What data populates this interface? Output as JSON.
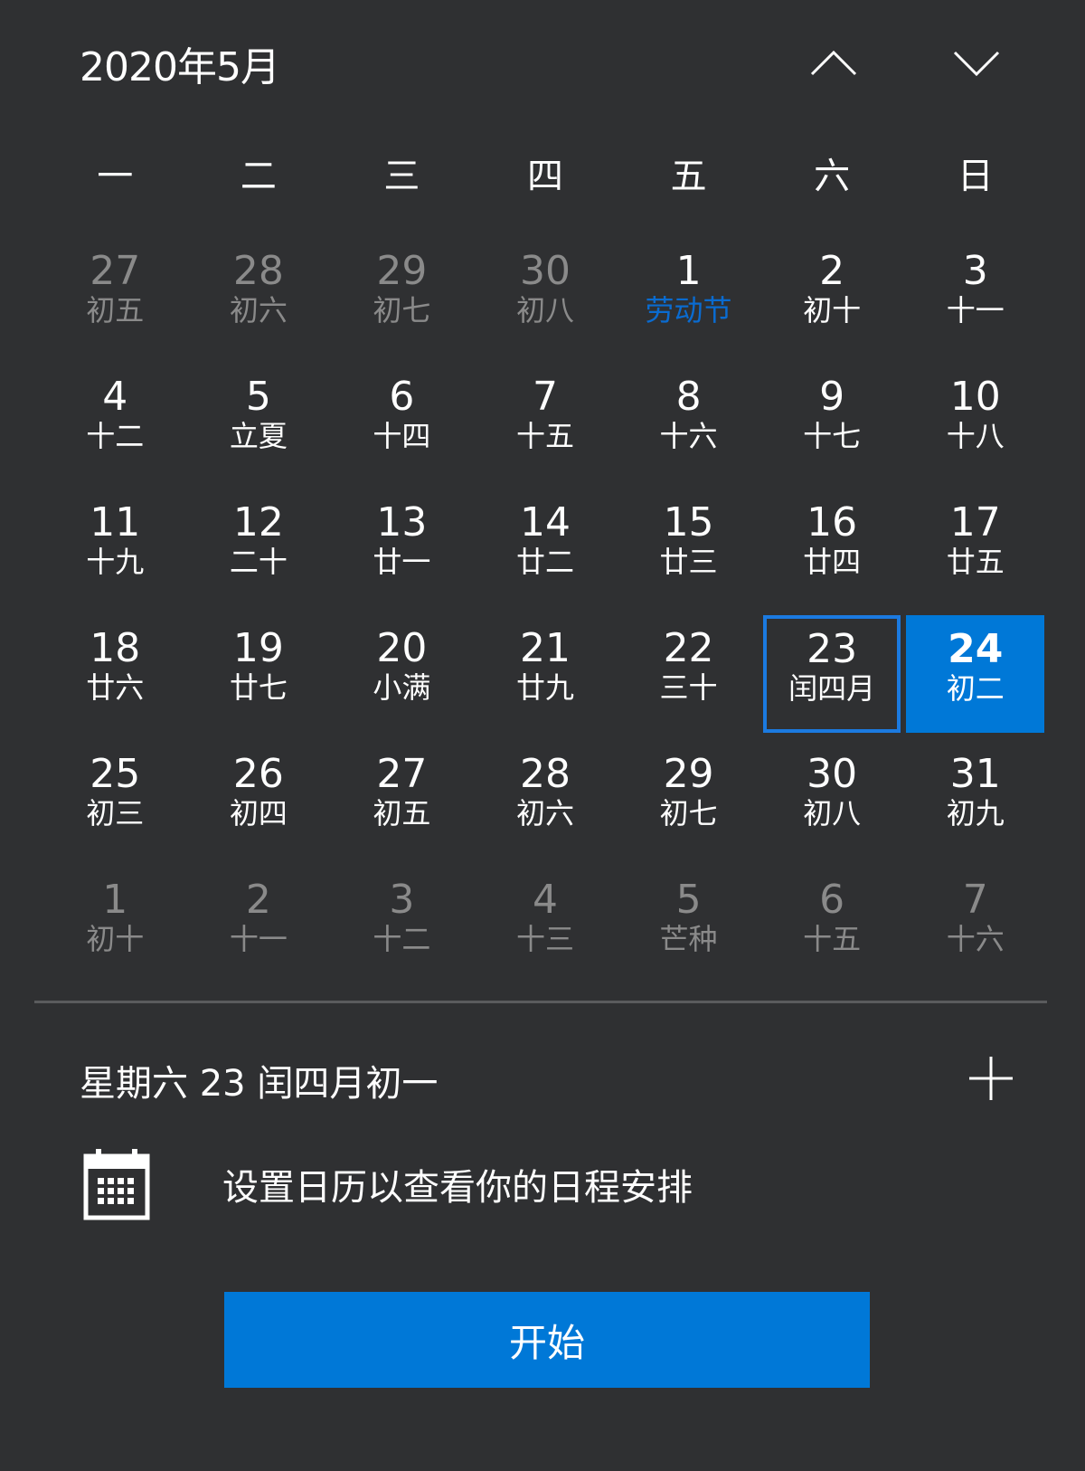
{
  "header": {
    "month_title": "2020年5月"
  },
  "weekdays": [
    "一",
    "二",
    "三",
    "四",
    "五",
    "六",
    "日"
  ],
  "days": [
    {
      "num": "27",
      "lunar": "初五",
      "state": "other"
    },
    {
      "num": "28",
      "lunar": "初六",
      "state": "other"
    },
    {
      "num": "29",
      "lunar": "初七",
      "state": "other"
    },
    {
      "num": "30",
      "lunar": "初八",
      "state": "other"
    },
    {
      "num": "1",
      "lunar": "劳动节",
      "state": "holiday"
    },
    {
      "num": "2",
      "lunar": "初十",
      "state": "normal"
    },
    {
      "num": "3",
      "lunar": "十一",
      "state": "normal"
    },
    {
      "num": "4",
      "lunar": "十二",
      "state": "normal"
    },
    {
      "num": "5",
      "lunar": "立夏",
      "state": "normal"
    },
    {
      "num": "6",
      "lunar": "十四",
      "state": "normal"
    },
    {
      "num": "7",
      "lunar": "十五",
      "state": "normal"
    },
    {
      "num": "8",
      "lunar": "十六",
      "state": "normal"
    },
    {
      "num": "9",
      "lunar": "十七",
      "state": "normal"
    },
    {
      "num": "10",
      "lunar": "十八",
      "state": "normal"
    },
    {
      "num": "11",
      "lunar": "十九",
      "state": "normal"
    },
    {
      "num": "12",
      "lunar": "二十",
      "state": "normal"
    },
    {
      "num": "13",
      "lunar": "廿一",
      "state": "normal"
    },
    {
      "num": "14",
      "lunar": "廿二",
      "state": "normal"
    },
    {
      "num": "15",
      "lunar": "廿三",
      "state": "normal"
    },
    {
      "num": "16",
      "lunar": "廿四",
      "state": "normal"
    },
    {
      "num": "17",
      "lunar": "廿五",
      "state": "normal"
    },
    {
      "num": "18",
      "lunar": "廿六",
      "state": "normal"
    },
    {
      "num": "19",
      "lunar": "廿七",
      "state": "normal"
    },
    {
      "num": "20",
      "lunar": "小满",
      "state": "normal"
    },
    {
      "num": "21",
      "lunar": "廿九",
      "state": "normal"
    },
    {
      "num": "22",
      "lunar": "三十",
      "state": "normal"
    },
    {
      "num": "23",
      "lunar": "闰四月",
      "state": "selected"
    },
    {
      "num": "24",
      "lunar": "初二",
      "state": "today"
    },
    {
      "num": "25",
      "lunar": "初三",
      "state": "normal"
    },
    {
      "num": "26",
      "lunar": "初四",
      "state": "normal"
    },
    {
      "num": "27",
      "lunar": "初五",
      "state": "normal"
    },
    {
      "num": "28",
      "lunar": "初六",
      "state": "normal"
    },
    {
      "num": "29",
      "lunar": "初七",
      "state": "normal"
    },
    {
      "num": "30",
      "lunar": "初八",
      "state": "normal"
    },
    {
      "num": "31",
      "lunar": "初九",
      "state": "normal"
    },
    {
      "num": "1",
      "lunar": "初十",
      "state": "other"
    },
    {
      "num": "2",
      "lunar": "十一",
      "state": "other"
    },
    {
      "num": "3",
      "lunar": "十二",
      "state": "other"
    },
    {
      "num": "4",
      "lunar": "十三",
      "state": "other"
    },
    {
      "num": "5",
      "lunar": "芒种",
      "state": "other"
    },
    {
      "num": "6",
      "lunar": "十五",
      "state": "other"
    },
    {
      "num": "7",
      "lunar": "十六",
      "state": "other"
    }
  ],
  "agenda": {
    "selected_date": "星期六 23 闰四月初一",
    "setup_text": "设置日历以查看你的日程安排",
    "start_label": "开始"
  },
  "icons": {
    "nav_up": "chevron-up-icon",
    "nav_down": "chevron-down-icon",
    "add": "plus-icon",
    "calendar": "calendar-icon"
  },
  "colors": {
    "background": "#2f3032",
    "accent": "#0078d7",
    "holiday": "#0a6bd0",
    "muted": "#8a8a8a"
  }
}
